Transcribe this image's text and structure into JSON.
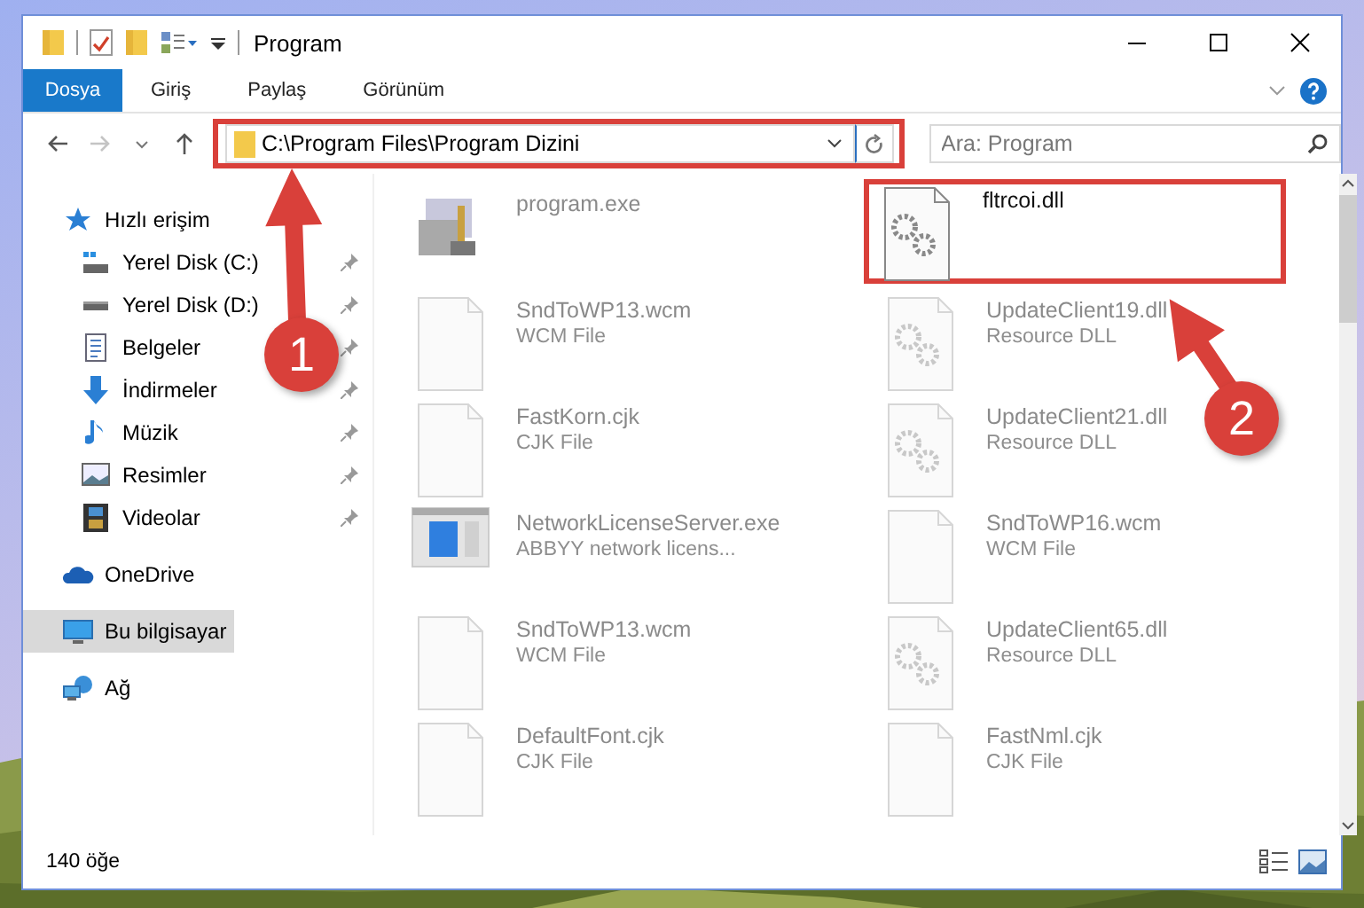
{
  "window": {
    "title": "Program"
  },
  "ribbon": {
    "tabs": [
      {
        "label": "Dosya",
        "kind": "file"
      },
      {
        "label": "Giriş",
        "kind": "tab"
      },
      {
        "label": "Paylaş",
        "kind": "tab"
      },
      {
        "label": "Görünüm",
        "kind": "tab"
      }
    ]
  },
  "address_bar": {
    "path": "C:\\Program Files\\Program Dizini"
  },
  "search": {
    "placeholder": "Ara: Program"
  },
  "navigation": [
    {
      "label": "Hızlı erişim",
      "selected": false,
      "children": [
        {
          "label": "Yerel Disk (C:)",
          "pinned": true,
          "selected": false
        },
        {
          "label": "Yerel Disk (D:)",
          "pinned": true,
          "selected": false
        },
        {
          "label": "Belgeler",
          "pinned": true,
          "selected": false
        },
        {
          "label": "İndirmeler",
          "pinned": true,
          "selected": false
        },
        {
          "label": "Müzik",
          "pinned": true,
          "selected": false
        },
        {
          "label": "Resimler",
          "pinned": true,
          "selected": false
        },
        {
          "label": "Videolar",
          "pinned": true,
          "selected": false
        }
      ]
    },
    {
      "label": "OneDrive",
      "selected": false
    },
    {
      "label": "Bu bilgisayar",
      "selected": true
    },
    {
      "label": "Ağ",
      "selected": false
    }
  ],
  "files": [
    {
      "name": "program.exe",
      "kind": "exe",
      "highlighted": false
    },
    {
      "name": "fltrcoi.dll",
      "kind": "dll",
      "highlighted": true
    },
    {
      "name": "SndToWP13.wcm",
      "type": "WCM File",
      "kind": "file",
      "highlighted": false
    },
    {
      "name": "UpdateClient19.dll",
      "type": "Resource DLL",
      "kind": "dll",
      "highlighted": false
    },
    {
      "name": "FastKorn.cjk",
      "type": "CJK File",
      "kind": "file",
      "highlighted": false
    },
    {
      "name": "UpdateClient21.dll",
      "type": "Resource DLL",
      "kind": "dll",
      "highlighted": false
    },
    {
      "name": "NetworkLicenseServer.exe",
      "type": "ABBYY network licens...",
      "kind": "app",
      "highlighted": false
    },
    {
      "name": "SndToWP16.wcm",
      "type": "WCM File",
      "kind": "file",
      "highlighted": false
    },
    {
      "name": "SndToWP13.wcm",
      "type": "WCM File",
      "kind": "file",
      "highlighted": false
    },
    {
      "name": "UpdateClient65.dll",
      "type": "Resource DLL",
      "kind": "dll",
      "highlighted": false
    },
    {
      "name": "DefaultFont.cjk",
      "type": "CJK File",
      "kind": "file",
      "highlighted": false
    },
    {
      "name": "FastNml.cjk",
      "type": "CJK File",
      "kind": "file",
      "highlighted": false
    }
  ],
  "status_bar": {
    "item_count": "140 öğe"
  },
  "annotations": [
    {
      "label": "1"
    },
    {
      "label": "2"
    }
  ]
}
